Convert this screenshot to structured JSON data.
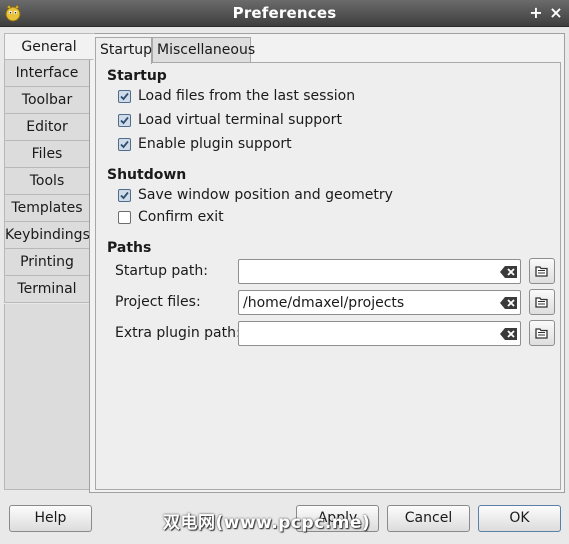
{
  "window": {
    "title": "Preferences",
    "maximize_glyph": "+",
    "close_glyph": "×"
  },
  "sidebar": {
    "items": [
      {
        "label": "General",
        "active": true
      },
      {
        "label": "Interface"
      },
      {
        "label": "Toolbar"
      },
      {
        "label": "Editor"
      },
      {
        "label": "Files"
      },
      {
        "label": "Tools"
      },
      {
        "label": "Templates"
      },
      {
        "label": "Keybindings"
      },
      {
        "label": "Printing"
      },
      {
        "label": "Terminal"
      }
    ]
  },
  "tabs": [
    {
      "label": "Startup",
      "active": true
    },
    {
      "label": "Miscellaneous"
    }
  ],
  "startup": {
    "title": "Startup",
    "options": [
      {
        "label": "Load files from the last session",
        "checked": true
      },
      {
        "label": "Load virtual terminal support",
        "checked": true
      },
      {
        "label": "Enable plugin support",
        "checked": true
      }
    ]
  },
  "shutdown": {
    "title": "Shutdown",
    "options": [
      {
        "label": "Save window position and geometry",
        "checked": true
      },
      {
        "label": "Confirm exit",
        "checked": false
      }
    ]
  },
  "paths": {
    "title": "Paths",
    "fields": [
      {
        "label": "Startup path:",
        "value": ""
      },
      {
        "label": "Project files:",
        "value": "/home/dmaxel/projects"
      },
      {
        "label": "Extra plugin path:",
        "value": ""
      }
    ]
  },
  "buttons": {
    "help": "Help",
    "apply": "Apply",
    "cancel": "Cancel",
    "ok": "OK"
  },
  "watermark": "双电网(www.pcpc.me)",
  "colors": {
    "titlebar": "#4a4a4a",
    "panel": "#eeeeee",
    "checkbox_checked": "#4f6b8a"
  }
}
